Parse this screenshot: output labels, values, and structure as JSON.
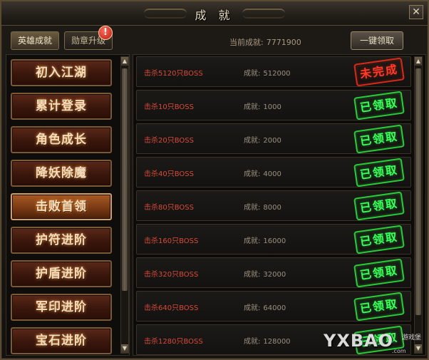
{
  "window": {
    "title": "成 就",
    "close_label": "✕"
  },
  "tabs": [
    {
      "label": "英雄成就",
      "active": true
    },
    {
      "label": "勋章升级",
      "active": false,
      "badge": "!"
    }
  ],
  "current_achievement": {
    "label": "当前成就:",
    "value": "7771900"
  },
  "claim_all_label": "一键领取",
  "categories": [
    {
      "label": "初入江湖"
    },
    {
      "label": "累计登录"
    },
    {
      "label": "角色成长"
    },
    {
      "label": "降妖除魔"
    },
    {
      "label": "击败首领",
      "active": true
    },
    {
      "label": "护符进阶"
    },
    {
      "label": "护盾进阶"
    },
    {
      "label": "军印进阶"
    },
    {
      "label": "宝石进阶"
    }
  ],
  "tasks": [
    {
      "name": "击杀5120只BOSS",
      "score_label": "成就:",
      "score": "512000",
      "status": "未完成",
      "completed": false
    },
    {
      "name": "击杀10只BOSS",
      "score_label": "成就:",
      "score": "1000",
      "status": "已领取",
      "completed": true
    },
    {
      "name": "击杀20只BOSS",
      "score_label": "成就:",
      "score": "2000",
      "status": "已领取",
      "completed": true
    },
    {
      "name": "击杀40只BOSS",
      "score_label": "成就:",
      "score": "4000",
      "status": "已领取",
      "completed": true
    },
    {
      "name": "击杀80只BOSS",
      "score_label": "成就:",
      "score": "8000",
      "status": "已领取",
      "completed": true
    },
    {
      "name": "击杀160只BOSS",
      "score_label": "成就:",
      "score": "16000",
      "status": "已领取",
      "completed": true
    },
    {
      "name": "击杀320只BOSS",
      "score_label": "成就:",
      "score": "32000",
      "status": "已领取",
      "completed": true
    },
    {
      "name": "击杀640只BOSS",
      "score_label": "成就:",
      "score": "64000",
      "status": "已领取",
      "completed": true
    },
    {
      "name": "击杀1280只BOSS",
      "score_label": "成就:",
      "score": "128000",
      "status": "已领取",
      "completed": true
    }
  ],
  "scrollbar": {
    "up": "▲",
    "down": "▼"
  },
  "watermark": {
    "brand": "YXBAO",
    "sub": "游戏堡",
    "url": ".com"
  },
  "colors": {
    "completed_stamp": "#3aff5a",
    "incomplete_stamp": "#ff3a2a",
    "task_text": "#d84a3a"
  }
}
